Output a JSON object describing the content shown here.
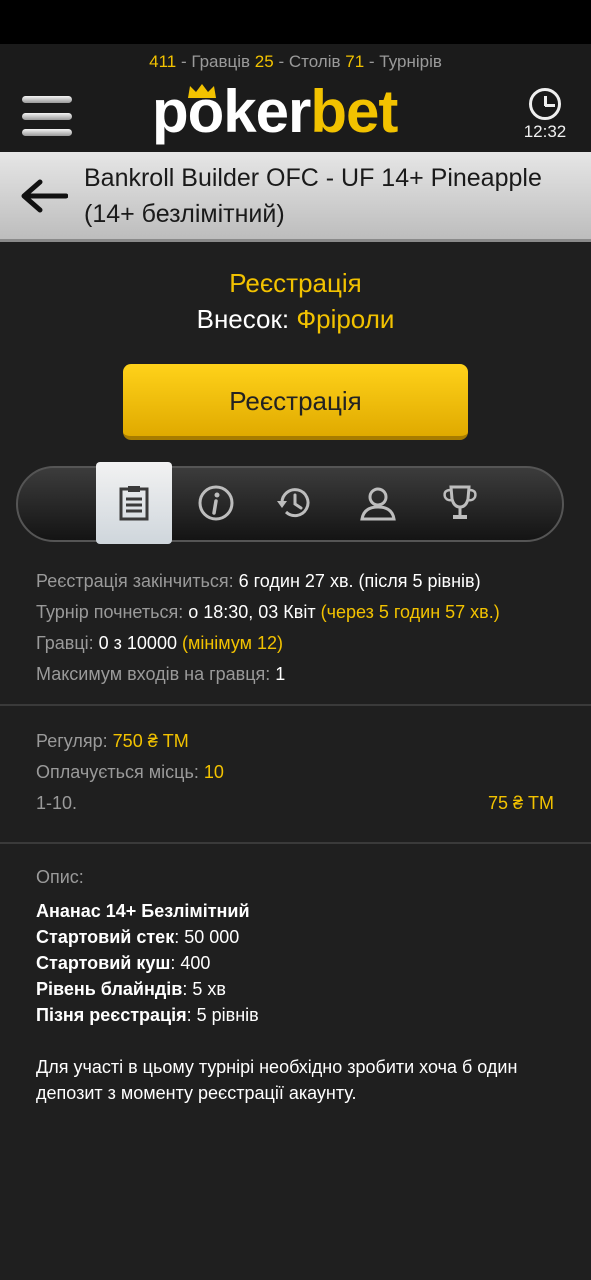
{
  "header": {
    "players_count": "411",
    "players_label": " - Гравців ",
    "tables_count": "25",
    "tables_label": " - Столів ",
    "tournaments_count": "71",
    "tournaments_label": " - Турнірів",
    "logo_part1": "poker",
    "logo_part2": "bet",
    "time": "12:32"
  },
  "title": {
    "text": "Bankroll Builder OFC - UF 14+ Pineapple (14+ безлімітний)"
  },
  "registration": {
    "heading": "Реєстрація",
    "buyin_label": "Внесок: ",
    "buyin_value": "Фріроли",
    "button_label": "Реєстрація"
  },
  "tabs": [
    {
      "icon": "clipboard-icon",
      "active": true
    },
    {
      "icon": "info-icon",
      "active": false
    },
    {
      "icon": "history-icon",
      "active": false
    },
    {
      "icon": "user-icon",
      "active": false
    },
    {
      "icon": "trophy-icon",
      "active": false
    }
  ],
  "info": {
    "reg_ends_label": "Реєстрація закінчиться: ",
    "reg_ends_value": "6 годин 27 хв. (після 5 рівнів)",
    "start_label": "Турнір почнеться: ",
    "start_value": "о 18:30, 03 Квіт ",
    "start_countdown": "(через 5 годин 57 хв.)",
    "players_label": "Гравці: ",
    "players_value": "0 з 10000 ",
    "players_min": "(мінімум 12)",
    "max_entries_label": "Максимум входів на гравця: ",
    "max_entries_value": "1"
  },
  "prize": {
    "regular_label": "Регуляр: ",
    "regular_value": "750 ₴ ТМ",
    "paid_label": "Оплачується місць: ",
    "paid_value": "10",
    "place_range": "1-10.",
    "place_prize": "75 ₴ ТМ"
  },
  "description": {
    "label": "Опис:",
    "line1_bold": "Ананас 14+ Безлімітний",
    "line2_bold": "Стартовий стек",
    "line2_value": ": 50 000",
    "line3_bold": "Стартовий куш",
    "line3_value": ": 400",
    "line4_bold": "Рівень блайндів",
    "line4_value": ": 5 хв",
    "line5_bold": "Пізня реєстрація",
    "line5_value": ": 5 рівнів",
    "note": "Для участі в цьому турнірі необхідно зробити хоча б один депозит з моменту реєстрації акаунту."
  }
}
